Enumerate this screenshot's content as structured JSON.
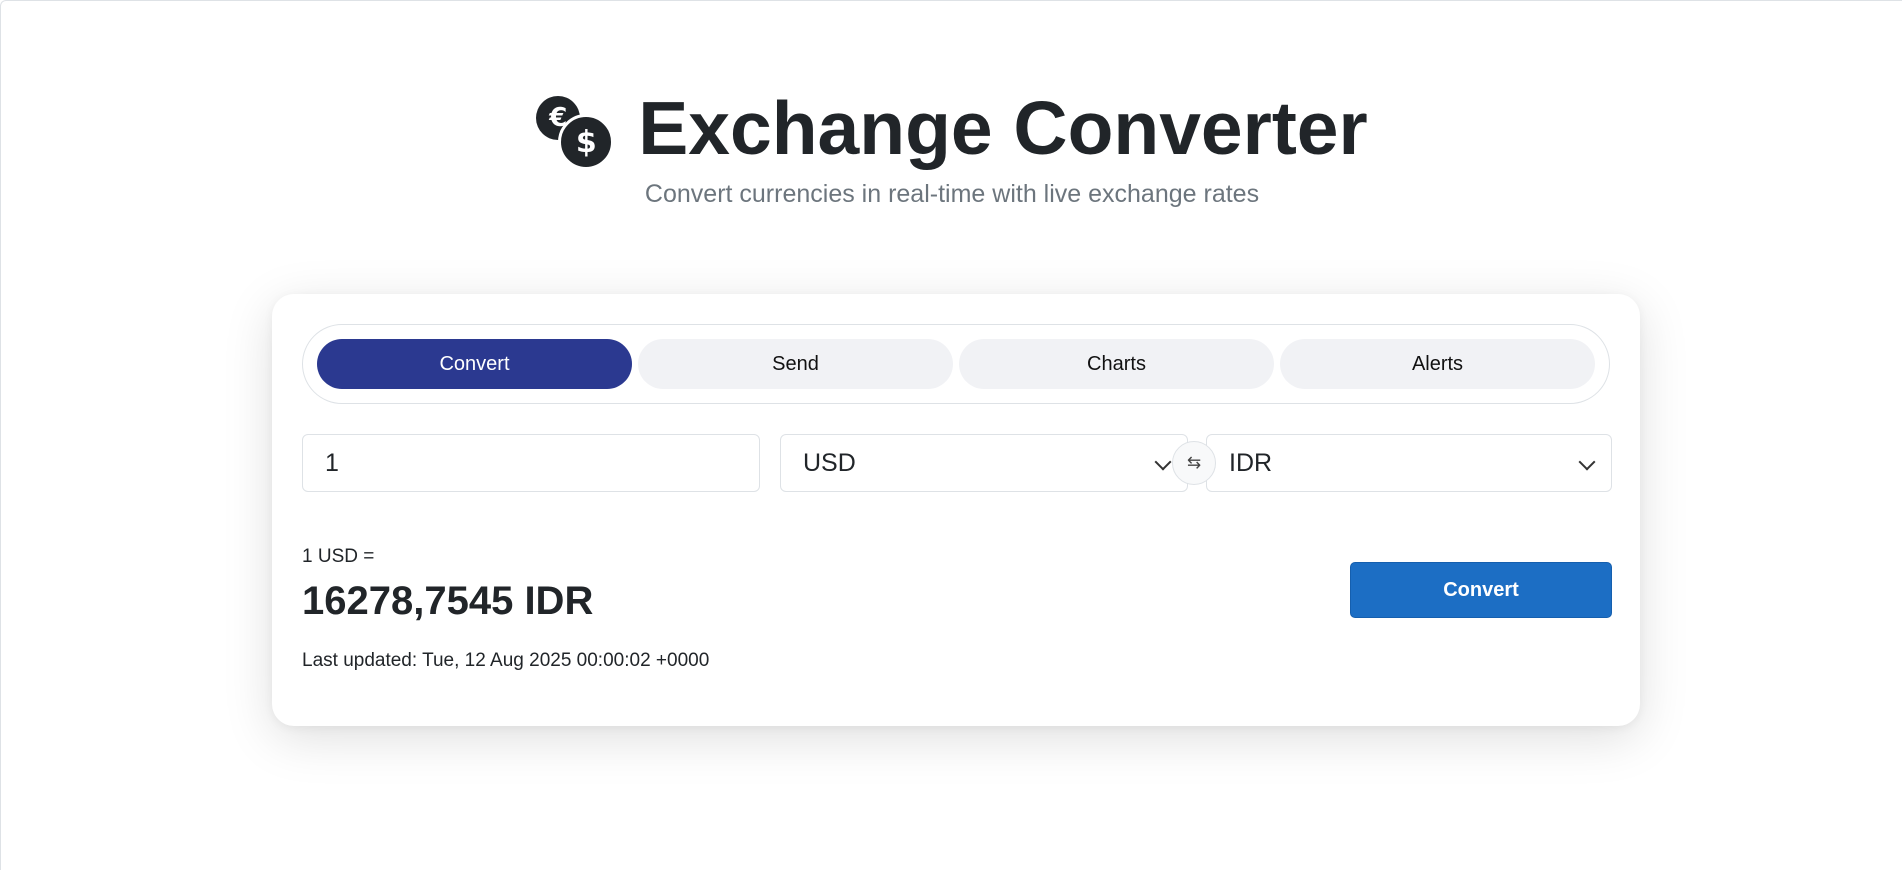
{
  "header": {
    "title": "Exchange Converter",
    "subtitle": "Convert currencies in real-time with live exchange rates",
    "logo": {
      "icon": "currency-exchange-icon",
      "euro_symbol": "€",
      "dollar_symbol": "$"
    }
  },
  "tabs": [
    {
      "label": "Convert",
      "active": true
    },
    {
      "label": "Send",
      "active": false
    },
    {
      "label": "Charts",
      "active": false
    },
    {
      "label": "Alerts",
      "active": false
    }
  ],
  "converter": {
    "amount": "1",
    "from_currency": "USD",
    "to_currency": "IDR",
    "swap_icon": "⇆",
    "rate_from_text": "1 USD =",
    "rate_result": "16278,7545 IDR",
    "last_updated": "Last updated: Tue, 12 Aug 2025 00:00:02 +0000",
    "convert_label": "Convert"
  },
  "colors": {
    "active_tab": "#2b3990",
    "primary_button": "#1c6ec4",
    "text": "#212529",
    "muted_text": "#6c757d"
  }
}
